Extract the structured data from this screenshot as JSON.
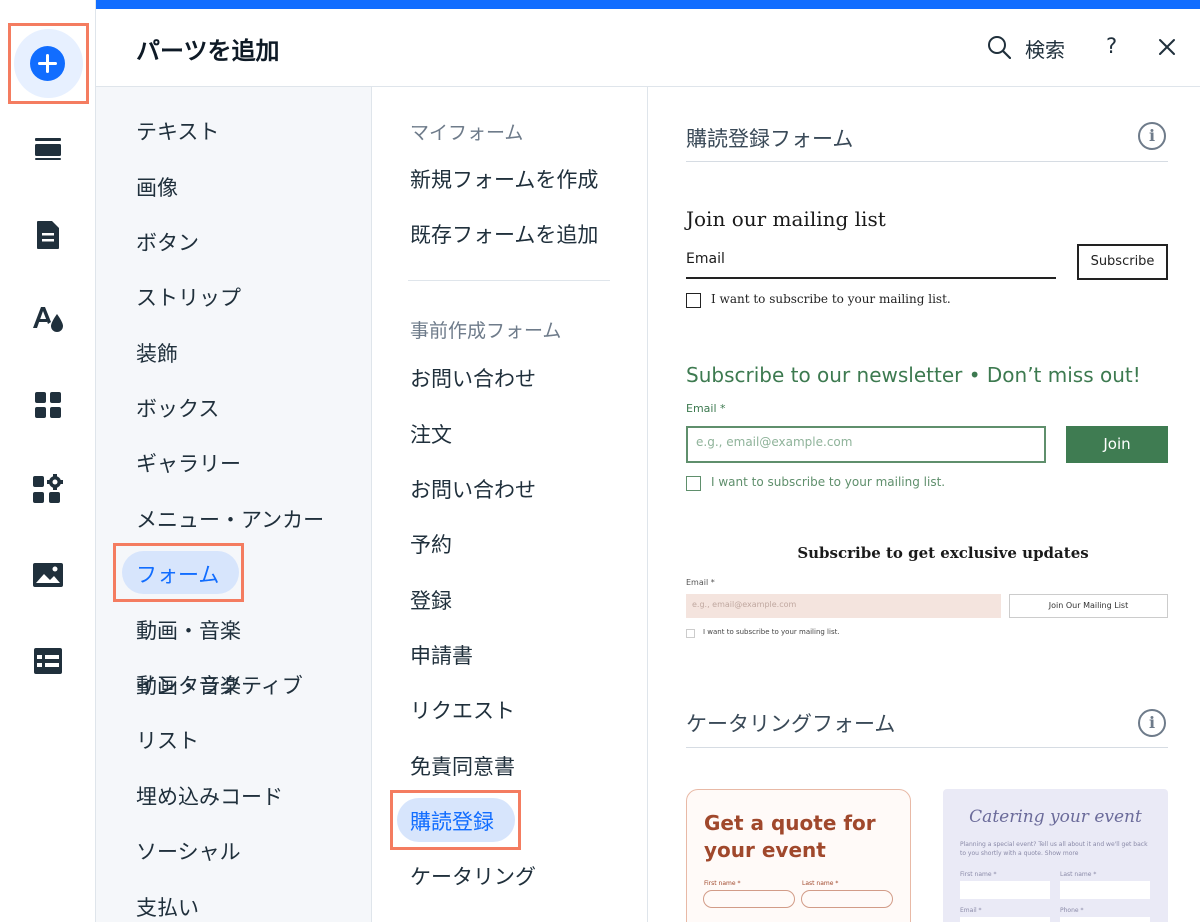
{
  "header": {
    "title": "パーツを追加",
    "search_label": "検索",
    "help_label": "?"
  },
  "rail": {
    "icons": [
      "add-icon",
      "strip-icon",
      "page-icon",
      "design-icon",
      "apps-icon",
      "plugin-icon",
      "media-icon",
      "table-icon"
    ]
  },
  "categories": {
    "items": [
      "テキスト",
      "画像",
      "ボタン",
      "ストリップ",
      "装飾",
      "ボックス",
      "ギャラリー",
      "メニュー・アンカー",
      "フォーム",
      "動画・音楽",
      "インタラクティブ",
      "リスト",
      "埋め込みコード",
      "ソーシャル",
      "支払い"
    ],
    "selected": "フォーム"
  },
  "forms": {
    "my_forms_heading": "マイフォーム",
    "my_forms": [
      "新規フォームを作成",
      "既存フォームを追加"
    ],
    "premade_heading": "事前作成フォーム",
    "premade": [
      "お問い合わせ",
      "注文",
      "お問い合わせ",
      "予約",
      "登録",
      "申請書",
      "リクエスト",
      "免責同意書",
      "購読登録",
      "ケータリング"
    ],
    "selected": "購読登録"
  },
  "preview": {
    "subscription_section": "購読登録フォーム",
    "catering_section": "ケータリングフォーム",
    "template1": {
      "title": "Join our mailing list",
      "email_label": "Email",
      "button": "Subscribe",
      "checkbox": "I want to subscribe to your mailing list."
    },
    "template2": {
      "title": "Subscribe to our newsletter • Don’t miss out!",
      "email_label": "Email *",
      "placeholder": "e.g., email@example.com",
      "button": "Join",
      "checkbox": "I want to subscribe to your mailing list."
    },
    "template3": {
      "title": "Subscribe to get exclusive updates",
      "email_label": "Email *",
      "placeholder": "e.g., email@example.com",
      "button": "Join Our Mailing List",
      "checkbox": "I want to subscribe to your mailing list."
    },
    "catering1": {
      "title_line1": "Get a quote for",
      "title_line2": "your event",
      "first_name": "First name *",
      "last_name": "Last name *"
    },
    "catering2": {
      "title": "Catering your event",
      "description": "Planning a special event? Tell us all about it and we'll get back to you shortly with a quote. Show more",
      "first_name": "First name *",
      "last_name": "Last name *",
      "email": "Email *",
      "phone": "Phone *"
    }
  },
  "colors": {
    "accent": "#116dff",
    "highlight_frame": "#f47c60",
    "selected_bg": "#d7e5fc",
    "green": "#3f7c52"
  }
}
